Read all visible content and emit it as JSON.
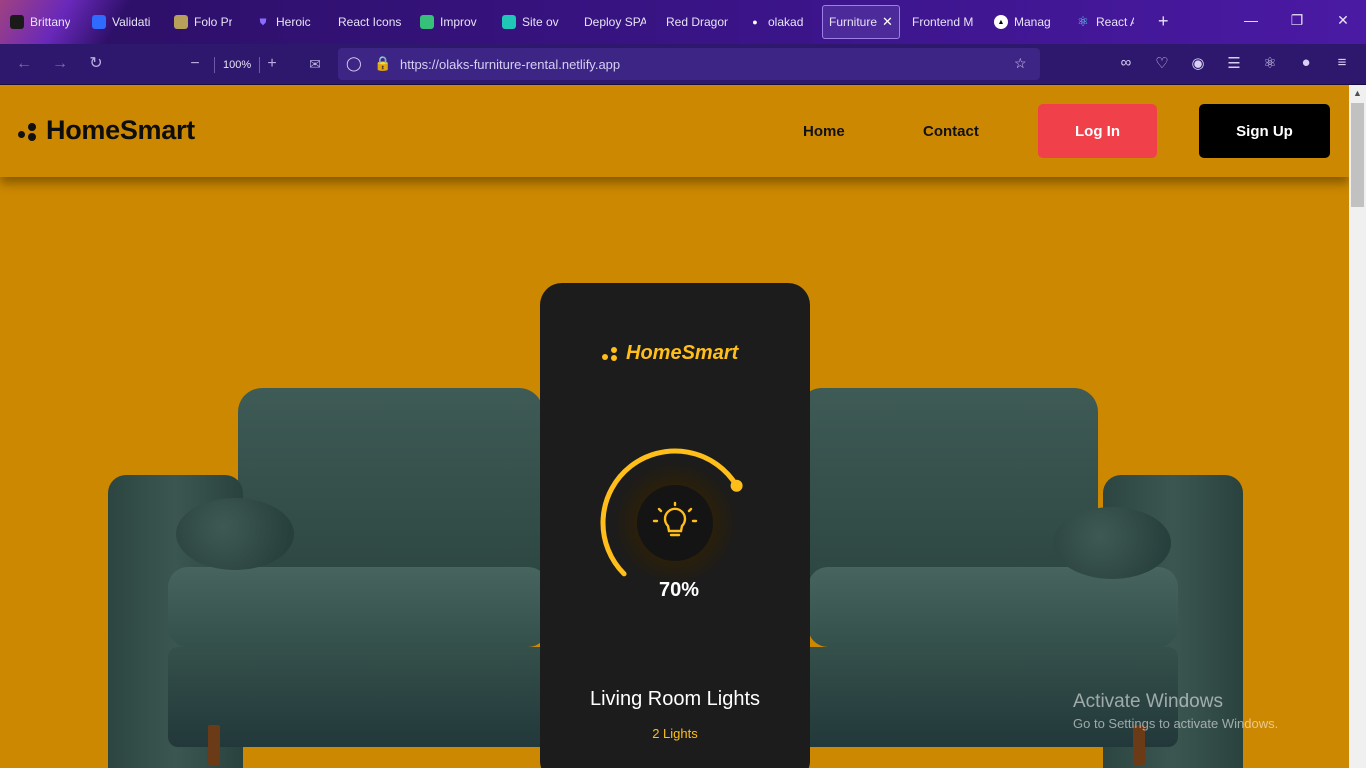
{
  "browser": {
    "tabs": [
      {
        "label": "Brittany",
        "icon": "b-logo-icon",
        "color": "#1a1a1a"
      },
      {
        "label": "Validati",
        "icon": "shield-blue-icon",
        "color": "#2f6bff"
      },
      {
        "label": "Folo Pr",
        "icon": "globe-icon",
        "color": "#b8a05a"
      },
      {
        "label": "Heroic",
        "icon": "shield-outline-icon",
        "color": "#8b6cff"
      },
      {
        "label": "React Icons",
        "icon": "",
        "color": ""
      },
      {
        "label": "Improv",
        "icon": "map-pin-icon",
        "color": "#36c07a"
      },
      {
        "label": "Site ov",
        "icon": "netlify-diamond-icon",
        "color": "#20c6b6"
      },
      {
        "label": "Deploy SPA",
        "icon": "",
        "color": ""
      },
      {
        "label": "Red Dragon",
        "icon": "",
        "color": ""
      },
      {
        "label": "olakad",
        "icon": "github-icon",
        "color": "#ffffff"
      },
      {
        "label": "Furniture",
        "icon": "",
        "color": "",
        "active": true
      },
      {
        "label": "Frontend M",
        "icon": "",
        "color": ""
      },
      {
        "label": "Manag",
        "icon": "triangle-icon",
        "color": "#000000"
      },
      {
        "label": "React A",
        "icon": "react-atom-icon",
        "color": "#61dafb"
      }
    ],
    "zoom": "100%",
    "url": "https://olaks-furniture-rental.netlify.app"
  },
  "site": {
    "logo": "HomeSmart",
    "nav": {
      "home": "Home",
      "contact": "Contact"
    },
    "login_label": "Log In",
    "signup_label": "Sign Up"
  },
  "card": {
    "logo": "HomeSmart",
    "level": 0.7,
    "percent_text": "70%",
    "room": "Living Room Lights",
    "lights": "2 Lights"
  },
  "watermark": {
    "line1": "Activate Windows",
    "line2": "Go to Settings to activate Windows."
  },
  "colors": {
    "page_bg": "#cc8800",
    "accent": "#ffbe1a",
    "login_bg": "#f0414a",
    "signup_bg": "#000000",
    "card_bg": "#1c1c1c"
  }
}
